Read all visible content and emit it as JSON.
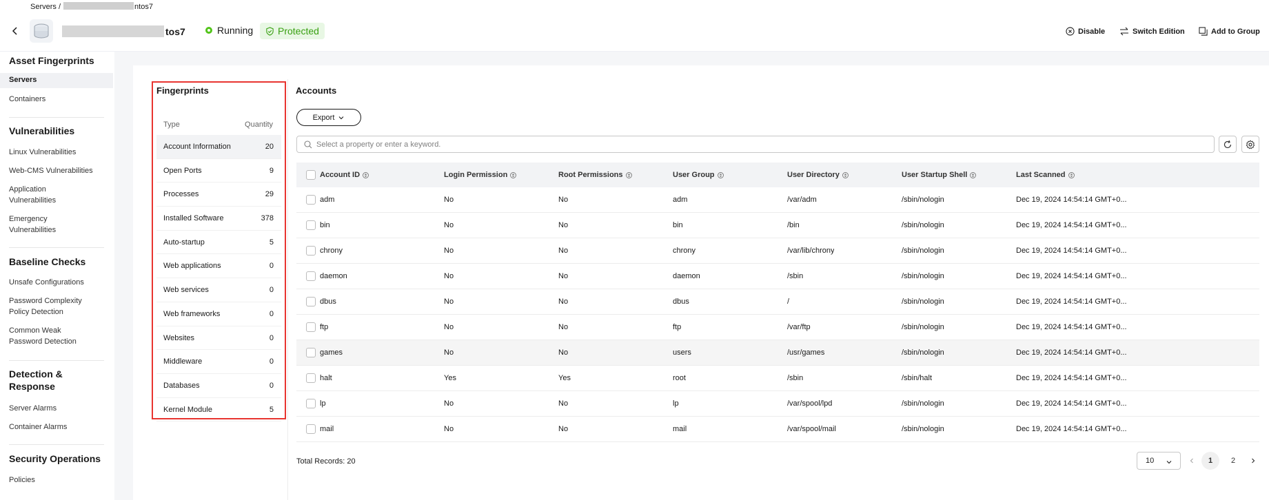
{
  "header": {
    "breadcrumb_root": "Servers",
    "breadcrumb_sep": "/",
    "breadcrumb_server_suffix": "ntos7",
    "server_name_suffix": "tos7",
    "status_running": "Running",
    "status_protected": "Protected",
    "actions": {
      "disable": "Disable",
      "switch_edition": "Switch Edition",
      "add_to_group": "Add to Group"
    }
  },
  "sidenav": {
    "asset_heading": "Asset Fingerprints",
    "servers": "Servers",
    "containers": "Containers",
    "vuln_heading": "Vulnerabilities",
    "linux_vuln": "Linux Vulnerabilities",
    "webcms_vuln": "Web-CMS Vulnerabilities",
    "app_vuln_1": "Application",
    "app_vuln_2": "Vulnerabilities",
    "emerg_vuln_1": "Emergency",
    "emerg_vuln_2": "Vulnerabilities",
    "baseline_heading": "Baseline Checks",
    "unsafe_configs": "Unsafe Configurations",
    "pwd_complex_1": "Password Complexity",
    "pwd_complex_2": "Policy Detection",
    "weak_pwd_1": "Common Weak",
    "weak_pwd_2": "Password Detection",
    "detect_heading_1": "Detection &",
    "detect_heading_2": "Response",
    "server_alarms": "Server Alarms",
    "container_alarms": "Container Alarms",
    "secops_heading": "Security Operations",
    "policies": "Policies"
  },
  "fingerprints": {
    "title": "Fingerprints",
    "col_type": "Type",
    "col_quantity": "Quantity",
    "rows": [
      {
        "label": "Account Information",
        "value": "20"
      },
      {
        "label": "Open Ports",
        "value": "9"
      },
      {
        "label": "Processes",
        "value": "29"
      },
      {
        "label": "Installed Software",
        "value": "378"
      },
      {
        "label": "Auto-startup",
        "value": "5"
      },
      {
        "label": "Web applications",
        "value": "0"
      },
      {
        "label": "Web services",
        "value": "0"
      },
      {
        "label": "Web frameworks",
        "value": "0"
      },
      {
        "label": "Websites",
        "value": "0"
      },
      {
        "label": "Middleware",
        "value": "0"
      },
      {
        "label": "Databases",
        "value": "0"
      },
      {
        "label": "Kernel Module",
        "value": "5"
      }
    ]
  },
  "accounts": {
    "title": "Accounts",
    "export_label": "Export",
    "search_placeholder": "Select a property or enter a keyword.",
    "columns": [
      "Account ID",
      "Login Permission",
      "Root Permissions",
      "User Group",
      "User Directory",
      "User Startup Shell",
      "Last Scanned"
    ],
    "rows": [
      [
        "adm",
        "No",
        "No",
        "adm",
        "/var/adm",
        "/sbin/nologin",
        "Dec 19, 2024 14:54:14 GMT+0..."
      ],
      [
        "bin",
        "No",
        "No",
        "bin",
        "/bin",
        "/sbin/nologin",
        "Dec 19, 2024 14:54:14 GMT+0..."
      ],
      [
        "chrony",
        "No",
        "No",
        "chrony",
        "/var/lib/chrony",
        "/sbin/nologin",
        "Dec 19, 2024 14:54:14 GMT+0..."
      ],
      [
        "daemon",
        "No",
        "No",
        "daemon",
        "/sbin",
        "/sbin/nologin",
        "Dec 19, 2024 14:54:14 GMT+0..."
      ],
      [
        "dbus",
        "No",
        "No",
        "dbus",
        "/",
        "/sbin/nologin",
        "Dec 19, 2024 14:54:14 GMT+0..."
      ],
      [
        "ftp",
        "No",
        "No",
        "ftp",
        "/var/ftp",
        "/sbin/nologin",
        "Dec 19, 2024 14:54:14 GMT+0..."
      ],
      [
        "games",
        "No",
        "No",
        "users",
        "/usr/games",
        "/sbin/nologin",
        "Dec 19, 2024 14:54:14 GMT+0..."
      ],
      [
        "halt",
        "Yes",
        "Yes",
        "root",
        "/sbin",
        "/sbin/halt",
        "Dec 19, 2024 14:54:14 GMT+0..."
      ],
      [
        "lp",
        "No",
        "No",
        "lp",
        "/var/spool/lpd",
        "/sbin/nologin",
        "Dec 19, 2024 14:54:14 GMT+0..."
      ],
      [
        "mail",
        "No",
        "No",
        "mail",
        "/var/spool/mail",
        "/sbin/nologin",
        "Dec 19, 2024 14:54:14 GMT+0..."
      ]
    ],
    "total_records": "Total Records: 20",
    "page_size": "10",
    "pages": [
      "1",
      "2"
    ]
  }
}
